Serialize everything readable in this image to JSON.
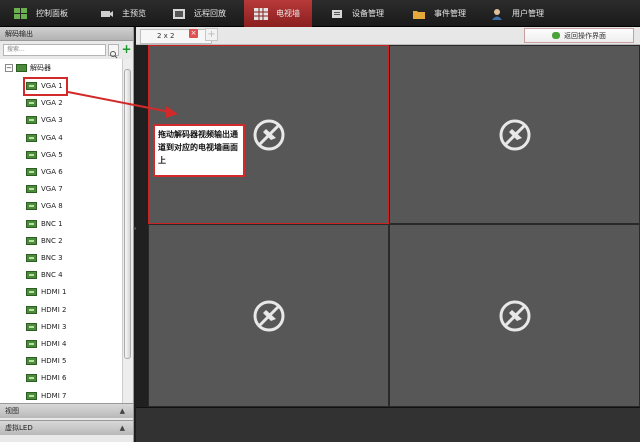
{
  "topnav": {
    "items": [
      {
        "label": "控制面板",
        "icon": "grid-icon"
      },
      {
        "label": "主预览",
        "icon": "camera-icon"
      },
      {
        "label": "远程回放",
        "icon": "film-icon"
      },
      {
        "label": "电视墙",
        "icon": "tv-wall-icon"
      },
      {
        "label": "设备管理",
        "icon": "gear-icon"
      },
      {
        "label": "事件管理",
        "icon": "folder-icon"
      },
      {
        "label": "用户管理",
        "icon": "user-icon"
      }
    ],
    "active_index": 3
  },
  "sidebar": {
    "title": "解码输出",
    "search_placeholder": "搜索...",
    "tree_root": "解码器",
    "channels": [
      "VGA 1",
      "VGA 2",
      "VGA 3",
      "VGA 4",
      "VGA 5",
      "VGA 6",
      "VGA 7",
      "VGA 8",
      "BNC 1",
      "BNC 2",
      "BNC 3",
      "BNC 4",
      "HDMI 1",
      "HDMI 2",
      "HDMI 3",
      "HDMI 4",
      "HDMI 5",
      "HDMI 6",
      "HDMI 7"
    ],
    "bottom_panels": [
      "视图",
      "虚拟LED"
    ]
  },
  "tabbar": {
    "tab_label": "2 x 2",
    "close_glyph": "×",
    "add_glyph": "+",
    "back_button": "返回操作界面"
  },
  "callout": {
    "text": "拖动解码器视频输出通道到对应的电视墙画面上"
  },
  "colors": {
    "accent": "#d22a2a",
    "tile_bg": "#575757",
    "channel_icon": "#4c8a3c"
  }
}
